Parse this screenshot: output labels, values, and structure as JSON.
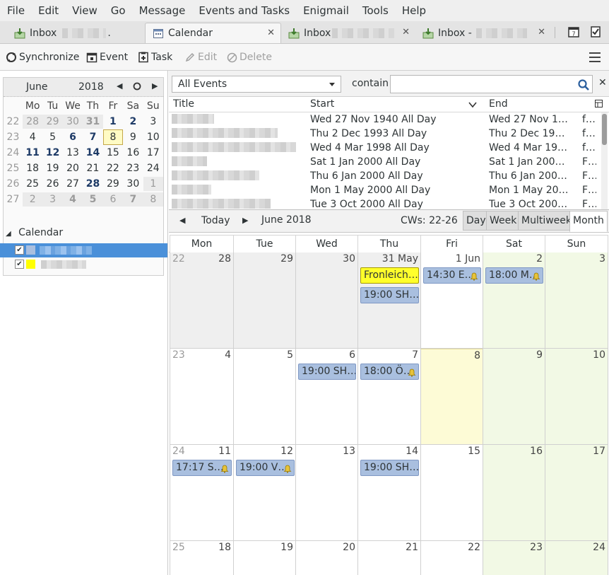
{
  "menu": [
    "File",
    "Edit",
    "View",
    "Go",
    "Message",
    "Events and Tasks",
    "Enigmail",
    "Tools",
    "Help"
  ],
  "tabs": [
    {
      "label": "Inbox",
      "suffix": "@",
      "tail": "."
    },
    {
      "label": "Calendar"
    },
    {
      "label": "Inbox"
    },
    {
      "label": "Inbox -"
    }
  ],
  "toolbar": {
    "synchronize": "Synchronize",
    "event": "Event",
    "task": "Task",
    "edit": "Edit",
    "delete": "Delete"
  },
  "minical": {
    "month": "June",
    "year": "2018",
    "dow": [
      "Mo",
      "Tu",
      "We",
      "Th",
      "Fr",
      "Sa",
      "Su"
    ],
    "weeks": [
      {
        "wk": "22",
        "days": [
          "28",
          "29",
          "30",
          "31",
          "1",
          "2",
          "3"
        ]
      },
      {
        "wk": "23",
        "days": [
          "4",
          "5",
          "6",
          "7",
          "8",
          "9",
          "10"
        ]
      },
      {
        "wk": "24",
        "days": [
          "11",
          "12",
          "13",
          "14",
          "15",
          "16",
          "17"
        ]
      },
      {
        "wk": "25",
        "days": [
          "18",
          "19",
          "20",
          "21",
          "22",
          "23",
          "24"
        ]
      },
      {
        "wk": "26",
        "days": [
          "25",
          "26",
          "27",
          "28",
          "29",
          "30",
          "1"
        ]
      },
      {
        "wk": "27",
        "days": [
          "2",
          "3",
          "4",
          "5",
          "6",
          "7",
          "8"
        ]
      }
    ]
  },
  "calendars": {
    "heading": "Calendar"
  },
  "search": {
    "filter": "All Events",
    "contain": "contain",
    "query": ""
  },
  "eventlist": {
    "columns": {
      "title": "Title",
      "start": "Start",
      "end": "End"
    },
    "rows": [
      {
        "start": "Wed 27 Nov 1940 All Day",
        "end": "Wed 27 Nov 1…",
        "cat": "f…"
      },
      {
        "start": "Thu 2 Dec 1993 All Day",
        "end": "Thu 2 Dec 19…",
        "cat": "f…"
      },
      {
        "start": "Wed 4 Mar 1998 All Day",
        "end": "Wed 4 Mar 19…",
        "cat": "f…"
      },
      {
        "start": "Sat 1 Jan 2000 All Day",
        "end": "Sat 1 Jan 200…",
        "cat": "F…"
      },
      {
        "start": "Thu 6 Jan 2000 All Day",
        "end": "Thu 6 Jan 200…",
        "cat": "F…"
      },
      {
        "start": "Mon 1 May 2000 All Day",
        "end": "Mon 1 May 20…",
        "cat": "F…"
      },
      {
        "start": "Tue 3 Oct 2000 All Day",
        "end": "Tue 3 Oct 200…",
        "cat": "F…"
      }
    ]
  },
  "nav": {
    "today": "Today",
    "label": "June 2018",
    "cws": "CWs: 22-26",
    "views": [
      "Day",
      "Week",
      "Multiweek",
      "Month"
    ],
    "active_view": "Month"
  },
  "month": {
    "dow": [
      "Mon",
      "Tue",
      "Wed",
      "Thu",
      "Fri",
      "Sat",
      "Sun"
    ],
    "weeks": [
      {
        "wk": "22",
        "days": [
          "28",
          "29",
          "30",
          "31 May",
          "1 Jun",
          "2",
          "3"
        ]
      },
      {
        "wk": "23",
        "days": [
          "4",
          "5",
          "6",
          "7",
          "8",
          "9",
          "10"
        ]
      },
      {
        "wk": "24",
        "days": [
          "11",
          "12",
          "13",
          "14",
          "15",
          "16",
          "17"
        ]
      },
      {
        "wk": "25",
        "days": [
          "18",
          "19",
          "20",
          "21",
          "22",
          "23",
          "24"
        ]
      }
    ],
    "events": {
      "fronleichnam": "Fronleich…",
      "thu31_sh": "19:00 SH…",
      "fri1": "14:30 E…",
      "sat2": "18:00 M…",
      "wed6": "19:00 SH…",
      "thu7": "18:00 Ö…",
      "mon11": "17:17 S…",
      "tue12": "19:00 V…",
      "thu14": "19:00 SH…"
    }
  },
  "colors": {
    "selection": "#4a90d9",
    "event_blue": "#a9bfdf",
    "event_yellow": "#ffff2b",
    "today_cell": "#fdfbd6",
    "weekend": "#f2f9e5",
    "calendar2_swatch": "#ffff00"
  }
}
